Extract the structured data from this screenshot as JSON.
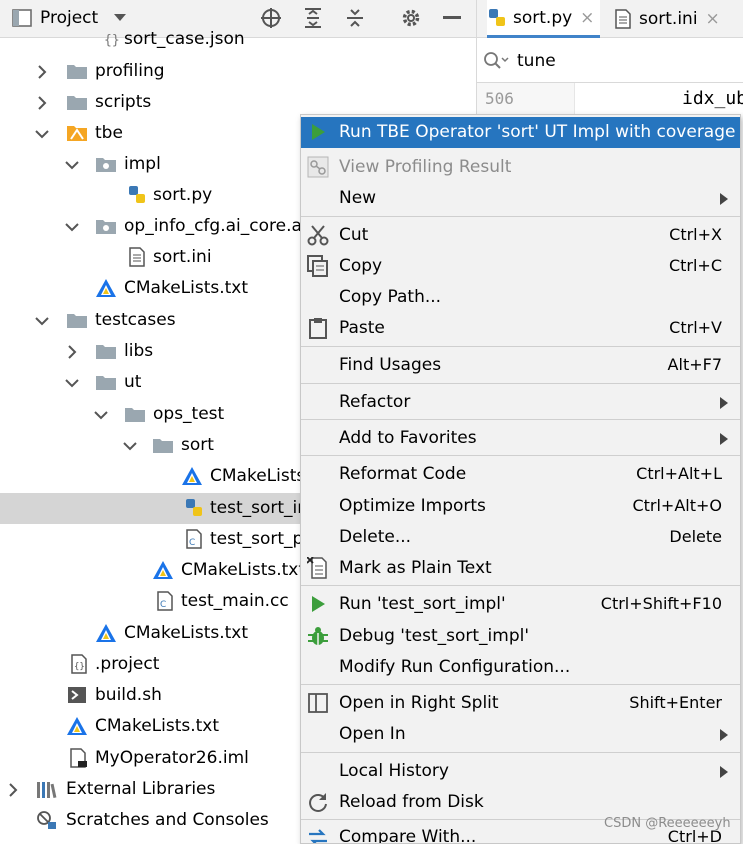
{
  "project_panel": {
    "title": "Project"
  },
  "tree": [
    {
      "label": "sort_case.json",
      "icon": "json-file-icon"
    },
    {
      "label": "profiling",
      "icon": "folder-icon"
    },
    {
      "label": "scripts",
      "icon": "folder-icon"
    },
    {
      "label": "tbe",
      "icon": "tbe-folder-icon"
    },
    {
      "label": "impl",
      "icon": "package-folder-icon"
    },
    {
      "label": "sort.py",
      "icon": "python-file-icon"
    },
    {
      "label": "op_info_cfg.ai_core.as",
      "icon": "package-folder-icon"
    },
    {
      "label": "sort.ini",
      "icon": "text-file-icon"
    },
    {
      "label": "CMakeLists.txt",
      "icon": "cmake-icon"
    },
    {
      "label": "testcases",
      "icon": "folder-icon"
    },
    {
      "label": "libs",
      "icon": "folder-icon"
    },
    {
      "label": "ut",
      "icon": "folder-icon"
    },
    {
      "label": "ops_test",
      "icon": "folder-icon"
    },
    {
      "label": "sort",
      "icon": "folder-icon"
    },
    {
      "label": "CMakeLists",
      "icon": "cmake-icon"
    },
    {
      "label": "test_sort_in",
      "icon": "python-file-icon"
    },
    {
      "label": "test_sort_p",
      "icon": "cpp-file-icon"
    },
    {
      "label": "CMakeLists.txt",
      "icon": "cmake-icon"
    },
    {
      "label": "test_main.cc",
      "icon": "cpp-file-icon"
    },
    {
      "label": "CMakeLists.txt",
      "icon": "cmake-icon"
    },
    {
      "label": ".project",
      "icon": "project-file-icon"
    },
    {
      "label": "build.sh",
      "icon": "shell-script-icon"
    },
    {
      "label": "CMakeLists.txt",
      "icon": "cmake-icon"
    },
    {
      "label": "MyOperator26.iml",
      "icon": "iml-file-icon"
    },
    {
      "label": "External Libraries",
      "icon": "library-icon"
    },
    {
      "label": "Scratches and Consoles",
      "icon": "scratches-icon"
    }
  ],
  "editor": {
    "tabs": [
      {
        "label": "sort.py",
        "icon": "python-file-icon",
        "close": "×"
      },
      {
        "label": "sort.ini",
        "icon": "text-file-icon",
        "close": "×"
      }
    ],
    "search_value": "tune",
    "line_number": "506",
    "code_fragment": "idx_ub"
  },
  "context_menu": {
    "items": [
      {
        "label": "Run TBE Operator 'sort' UT Impl with coverage",
        "shortcut": "",
        "icon": "run-coverage-icon"
      },
      {
        "label": "View Profiling Result",
        "shortcut": "",
        "icon": "profiling-icon"
      },
      {
        "label": "New",
        "shortcut": "",
        "icon": ""
      },
      {
        "label": "Cut",
        "shortcut": "Ctrl+X",
        "icon": "scissors-icon"
      },
      {
        "label": "Copy",
        "shortcut": "Ctrl+C",
        "icon": "copy-icon"
      },
      {
        "label": "Copy Path...",
        "shortcut": "",
        "icon": ""
      },
      {
        "label": "Paste",
        "shortcut": "Ctrl+V",
        "icon": "clipboard-icon"
      },
      {
        "label": "Find Usages",
        "shortcut": "Alt+F7",
        "icon": ""
      },
      {
        "label": "Refactor",
        "shortcut": "",
        "icon": ""
      },
      {
        "label": "Add to Favorites",
        "shortcut": "",
        "icon": ""
      },
      {
        "label": "Reformat Code",
        "shortcut": "Ctrl+Alt+L",
        "icon": ""
      },
      {
        "label": "Optimize Imports",
        "shortcut": "Ctrl+Alt+O",
        "icon": ""
      },
      {
        "label": "Delete...",
        "shortcut": "Delete",
        "icon": ""
      },
      {
        "label": "Mark as Plain Text",
        "shortcut": "",
        "icon": "plain-text-icon"
      },
      {
        "label": "Run 'test_sort_impl'",
        "shortcut": "Ctrl+Shift+F10",
        "icon": "run-icon"
      },
      {
        "label": "Debug 'test_sort_impl'",
        "shortcut": "",
        "icon": "debug-bug-icon"
      },
      {
        "label": "Modify Run Configuration...",
        "shortcut": "",
        "icon": ""
      },
      {
        "label": "Open in Right Split",
        "shortcut": "Shift+Enter",
        "icon": "split-icon"
      },
      {
        "label": "Open In",
        "shortcut": "",
        "icon": ""
      },
      {
        "label": "Local History",
        "shortcut": "",
        "icon": ""
      },
      {
        "label": "Reload from Disk",
        "shortcut": "",
        "icon": "reload-icon"
      },
      {
        "label": "Compare With...",
        "shortcut": "Ctrl+D",
        "icon": "compare-icon"
      }
    ]
  },
  "watermark": "CSDN @Reeeeeeyh",
  "colors": {
    "selection": "#2675bf",
    "menu_bg": "#f2f2f2",
    "run_green": "#3c9e3c",
    "folder_gray": "#9aa7b0",
    "tbe_orange": "#f5a623",
    "cmake_blue": "#1a73e8"
  }
}
